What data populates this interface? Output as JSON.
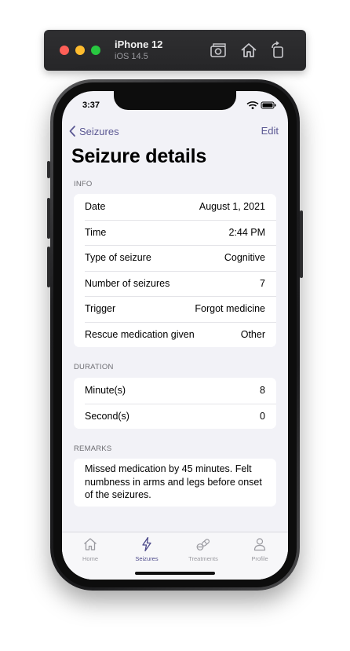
{
  "simulator": {
    "device_name": "iPhone 12",
    "os_version": "iOS 14.5"
  },
  "status_bar": {
    "time": "3:37"
  },
  "nav": {
    "back_label": "Seizures",
    "edit_label": "Edit",
    "title": "Seizure details"
  },
  "sections": {
    "info": {
      "header": "INFO",
      "rows": [
        {
          "label": "Date",
          "value": "August 1, 2021"
        },
        {
          "label": "Time",
          "value": "2:44 PM"
        },
        {
          "label": "Type of seizure",
          "value": "Cognitive"
        },
        {
          "label": "Number of seizures",
          "value": "7"
        },
        {
          "label": "Trigger",
          "value": "Forgot medicine"
        },
        {
          "label": "Rescue medication given",
          "value": "Other"
        }
      ]
    },
    "duration": {
      "header": "DURATION",
      "rows": [
        {
          "label": "Minute(s)",
          "value": "8"
        },
        {
          "label": "Second(s)",
          "value": "0"
        }
      ]
    },
    "remarks": {
      "header": "REMARKS",
      "text": "Missed medication by 45 minutes. Felt numbness in arms and legs before onset of the seizures."
    }
  },
  "tabbar": {
    "tabs": [
      {
        "label": "Home",
        "icon": "house-icon",
        "active": false
      },
      {
        "label": "Seizures",
        "icon": "bolt-icon",
        "active": true
      },
      {
        "label": "Treatments",
        "icon": "pills-icon",
        "active": false
      },
      {
        "label": "Profile",
        "icon": "person-icon",
        "active": false
      }
    ]
  },
  "colors": {
    "accent": "#5b5893",
    "tab_active": "#4d4a8a",
    "tab_inactive": "#9a9aa0",
    "background": "#f2f2f7"
  }
}
